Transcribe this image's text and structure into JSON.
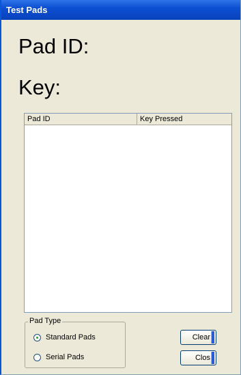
{
  "window": {
    "title": "Test Pads"
  },
  "labels": {
    "pad_id": "Pad ID:",
    "key": "Key:"
  },
  "listview": {
    "columns": [
      "Pad ID",
      "Key Pressed"
    ],
    "rows": []
  },
  "pad_type": {
    "title": "Pad Type",
    "options": [
      {
        "label": "Standard Pads",
        "selected": true
      },
      {
        "label": "Serial Pads",
        "selected": false
      }
    ]
  },
  "buttons": {
    "clear": "Clear",
    "close": "Clos"
  }
}
